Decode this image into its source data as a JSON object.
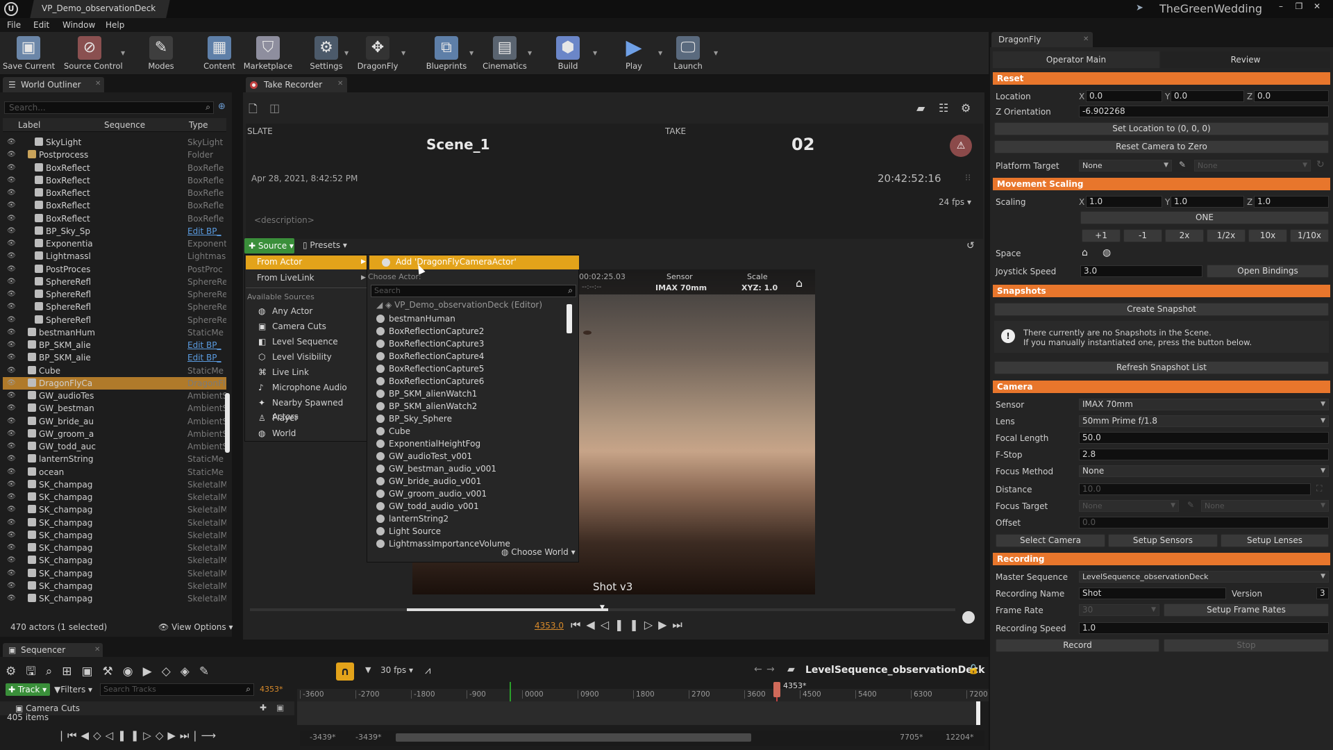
{
  "titlebar": {
    "project_tab": "VP_Demo_observationDeck",
    "user": "TheGreenWedding"
  },
  "menu": [
    "File",
    "Edit",
    "Window",
    "Help"
  ],
  "toolbar": [
    {
      "label": "Save Current",
      "icon": "save-icon"
    },
    {
      "label": "Source Control",
      "icon": "source-control-icon"
    },
    {
      "label": "Modes",
      "icon": "modes-icon"
    },
    {
      "label": "Content",
      "icon": "content-icon"
    },
    {
      "label": "Marketplace",
      "icon": "marketplace-icon"
    },
    {
      "label": "Settings",
      "icon": "settings-icon"
    },
    {
      "label": "DragonFly",
      "icon": "dragonfly-icon"
    },
    {
      "label": "Blueprints",
      "icon": "blueprints-icon"
    },
    {
      "label": "Cinematics",
      "icon": "cinematics-icon"
    },
    {
      "label": "Build",
      "icon": "build-icon"
    },
    {
      "label": "Play",
      "icon": "play-icon"
    },
    {
      "label": "Launch",
      "icon": "launch-icon"
    }
  ],
  "outliner": {
    "tab": "World Outliner",
    "search_placeholder": "Search...",
    "columns": {
      "label": "Label",
      "sequence": "Sequence",
      "type": "Type"
    },
    "rows": [
      {
        "label": "SkyLight",
        "type": "SkyLight",
        "indent": 2
      },
      {
        "label": "Postprocess",
        "type": "Folder",
        "indent": 1
      },
      {
        "label": "BoxReflect",
        "type": "BoxRefle",
        "indent": 2
      },
      {
        "label": "BoxReflect",
        "type": "BoxRefle",
        "indent": 2
      },
      {
        "label": "BoxReflect",
        "type": "BoxRefle",
        "indent": 2
      },
      {
        "label": "BoxReflect",
        "type": "BoxRefle",
        "indent": 2
      },
      {
        "label": "BoxReflect",
        "type": "BoxRefle",
        "indent": 2
      },
      {
        "label": "BP_Sky_Sp",
        "type": "Edit BP_",
        "indent": 2,
        "link": true
      },
      {
        "label": "Exponentia",
        "type": "Exponent",
        "indent": 2
      },
      {
        "label": "Lightmassl",
        "type": "Lightmas",
        "indent": 2
      },
      {
        "label": "PostProces",
        "type": "PostProc",
        "indent": 2
      },
      {
        "label": "SphereRefl",
        "type": "SphereRe",
        "indent": 2
      },
      {
        "label": "SphereRefl",
        "type": "SphereRe",
        "indent": 2
      },
      {
        "label": "SphereRefl",
        "type": "SphereRe",
        "indent": 2
      },
      {
        "label": "SphereRefl",
        "type": "SphereRe",
        "indent": 2
      },
      {
        "label": "bestmanHum",
        "type": "StaticMe",
        "indent": 1
      },
      {
        "label": "BP_SKM_alie",
        "type": "Edit BP_",
        "indent": 1,
        "link": true
      },
      {
        "label": "BP_SKM_alie",
        "type": "Edit BP_",
        "indent": 1,
        "link": true
      },
      {
        "label": "Cube",
        "type": "StaticMe",
        "indent": 1
      },
      {
        "label": "DragonFlyCa",
        "type": "DragonFl",
        "indent": 1,
        "selected": true
      },
      {
        "label": "GW_audioTes",
        "type": "AmbientS",
        "indent": 1
      },
      {
        "label": "GW_bestman",
        "type": "AmbientS",
        "indent": 1
      },
      {
        "label": "GW_bride_au",
        "type": "AmbientS",
        "indent": 1
      },
      {
        "label": "GW_groom_a",
        "type": "AmbientS",
        "indent": 1
      },
      {
        "label": "GW_todd_auc",
        "type": "AmbientS",
        "indent": 1
      },
      {
        "label": "lanternString",
        "type": "StaticMe",
        "indent": 1
      },
      {
        "label": "ocean",
        "type": "StaticMe",
        "indent": 1
      },
      {
        "label": "SK_champag",
        "type": "SkeletalM",
        "indent": 1
      },
      {
        "label": "SK_champag",
        "type": "SkeletalM",
        "indent": 1
      },
      {
        "label": "SK_champag",
        "type": "SkeletalM",
        "indent": 1
      },
      {
        "label": "SK_champag",
        "type": "SkeletalM",
        "indent": 1
      },
      {
        "label": "SK_champag",
        "type": "SkeletalM",
        "indent": 1
      },
      {
        "label": "SK_champag",
        "type": "SkeletalM",
        "indent": 1
      },
      {
        "label": "SK_champag",
        "type": "SkeletalM",
        "indent": 1
      },
      {
        "label": "SK_champag",
        "type": "SkeletalM",
        "indent": 1
      },
      {
        "label": "SK_champag",
        "type": "SkeletalM",
        "indent": 1
      },
      {
        "label": "SK_champag",
        "type": "SkeletalM",
        "indent": 1
      }
    ],
    "footer": "470 actors (1 selected)",
    "view_options": "View Options"
  },
  "take_recorder": {
    "tab": "Take Recorder",
    "slate_label": "SLATE",
    "slate_value": "Scene_1",
    "take_label": "TAKE",
    "take_value": "02",
    "date": "Apr 28, 2021, 8:42:52 PM",
    "timecode": "20:42:52:16",
    "fps": "24 fps",
    "description_placeholder": "<description>",
    "source_button": "Source",
    "presets_button": "Presets"
  },
  "source_menu": {
    "items": [
      "From Actor",
      "From LiveLink"
    ],
    "available_sources_label": "Available Sources",
    "sources": [
      "Any Actor",
      "Camera Cuts",
      "Level Sequence",
      "Level Visibility",
      "Live Link",
      "Microphone Audio",
      "Nearby Spawned Actors",
      "Player",
      "World"
    ]
  },
  "actor_menu": {
    "add_item": "Add 'DragonFlyCameraActor'",
    "choose_actor": "Choose Actor:",
    "search_placeholder": "Search",
    "root": "VP_Demo_observationDeck (Editor)",
    "actors": [
      "bestmanHuman",
      "BoxReflectionCapture2",
      "BoxReflectionCapture3",
      "BoxReflectionCapture4",
      "BoxReflectionCapture5",
      "BoxReflectionCapture6",
      "BP_SKM_alienWatch1",
      "BP_SKM_alienWatch2",
      "BP_Sky_Sphere",
      "Cube",
      "ExponentialHeightFog",
      "GW_audioTest_v001",
      "GW_bestman_audio_v001",
      "GW_bride_audio_v001",
      "GW_groom_audio_v001",
      "GW_todd_audio_v001",
      "lanternString2",
      "Light Source",
      "LightmassImportanceVolume"
    ],
    "choose_world": "Choose World"
  },
  "viewport": {
    "timecode": "00:02:25.03",
    "timecode2": "--:--:--",
    "sensor_label": "Sensor",
    "sensor_value": "IMAX 70mm",
    "scale_label": "Scale",
    "scale_value": "XYZ: 1.0",
    "shot_label": "Shot v3",
    "frame": "4353.0"
  },
  "sequencer": {
    "tab": "Sequencer",
    "fps": "30 fps",
    "sequence_name": "LevelSequence_observationDeck",
    "track_button": "Track",
    "filters_button": "Filters",
    "search_placeholder": "Search Tracks",
    "current_frame": "4353*",
    "camera_cuts": "Camera Cuts",
    "items_count": "405 items",
    "ruler": [
      "-3600",
      "-2700",
      "-1800",
      "-900",
      "0000",
      "0900",
      "1800",
      "2700",
      "3600",
      "4500",
      "5400",
      "6300",
      "7200"
    ],
    "playhead_label": "4353*",
    "range_start1": "-3439*",
    "range_start2": "-3439*",
    "range_end1": "7705*",
    "range_end2": "12204*"
  },
  "dragonfly": {
    "tab": "DragonFly",
    "subtabs": [
      "Operator Main",
      "Review"
    ],
    "reset_section": "Reset",
    "location_label": "Location",
    "location": {
      "x": "0.0",
      "y": "0.0",
      "z": "0.0"
    },
    "z_orientation_label": "Z Orientation",
    "z_orientation": "-6.902268",
    "set_location_button": "Set Location to (0, 0, 0)",
    "reset_camera_button": "Reset Camera to Zero",
    "platform_target_label": "Platform Target",
    "platform_target": "None",
    "platform_target2": "None",
    "movement_section": "Movement Scaling",
    "scaling_label": "Scaling",
    "scaling": {
      "x": "1.0",
      "y": "1.0",
      "z": "1.0"
    },
    "one_button": "ONE",
    "scale_buttons": [
      "+1",
      "-1",
      "2x",
      "1/2x",
      "10x",
      "1/10x"
    ],
    "space_label": "Space",
    "joystick_label": "Joystick Speed",
    "joystick_speed": "3.0",
    "open_bindings": "Open Bindings",
    "snapshots_section": "Snapshots",
    "create_snapshot": "Create Snapshot",
    "snapshot_msg1": "There currently are no Snapshots in the Scene.",
    "snapshot_msg2": "If you manually instantiated one, press the button below.",
    "refresh_snapshot": "Refresh Snapshot List",
    "camera_section": "Camera",
    "sensor_label": "Sensor",
    "sensor": "IMAX 70mm",
    "lens_label": "Lens",
    "lens": "50mm Prime f/1.8",
    "focal_label": "Focal Length",
    "focal": "50.0",
    "fstop_label": "F-Stop",
    "fstop": "2.8",
    "focus_method_label": "Focus Method",
    "focus_method": "None",
    "distance_label": "Distance",
    "distance": "10.0",
    "focus_target_label": "Focus Target",
    "focus_target": "None",
    "focus_target2": "None",
    "offset_label": "Offset",
    "offset": "0.0",
    "select_camera": "Select Camera",
    "setup_sensors": "Setup Sensors",
    "setup_lenses": "Setup Lenses",
    "recording_section": "Recording",
    "master_seq_label": "Master Sequence",
    "master_seq": "LevelSequence_observationDeck",
    "rec_name_label": "Recording Name",
    "rec_name": "Shot",
    "version_label": "Version",
    "version": "3",
    "frame_rate_label": "Frame Rate",
    "frame_rate": "30",
    "setup_frame_rates": "Setup Frame Rates",
    "rec_speed_label": "Recording Speed",
    "rec_speed": "1.0",
    "record": "Record",
    "stop": "Stop"
  },
  "colors": {
    "accent": "#e8762c",
    "menu_highlight": "#e3a31a",
    "selected_row": "#b07a2a",
    "source_button": "#3a8f3a"
  }
}
